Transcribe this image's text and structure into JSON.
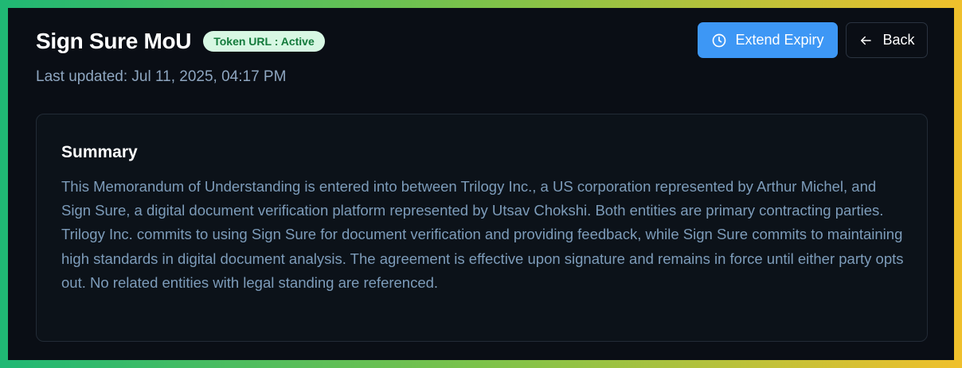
{
  "header": {
    "title": "Sign Sure MoU",
    "badge": "Token URL : Active",
    "last_updated": "Last updated: Jul 11, 2025, 04:17 PM"
  },
  "actions": {
    "extend_label": "Extend Expiry",
    "back_label": "Back"
  },
  "summary": {
    "title": "Summary",
    "text": "This Memorandum of Understanding is entered into between Trilogy Inc., a US corporation represented by Arthur Michel, and Sign Sure, a digital document verification platform represented by Utsav Chokshi. Both entities are primary contracting parties. Trilogy Inc. commits to using Sign Sure for document verification and providing feedback, while Sign Sure commits to maintaining high standards in digital document analysis. The agreement is effective upon signature and remains in force until either party opts out. No related entities with legal standing are referenced."
  },
  "icons": {
    "extend": "clock-icon",
    "back": "arrow-left-icon"
  },
  "colors": {
    "background": "#0a0e15",
    "accent": "#3d97f5",
    "badge_bg": "#d7f7e3",
    "badge_text": "#137a3b",
    "muted_text": "#7d9cba"
  }
}
